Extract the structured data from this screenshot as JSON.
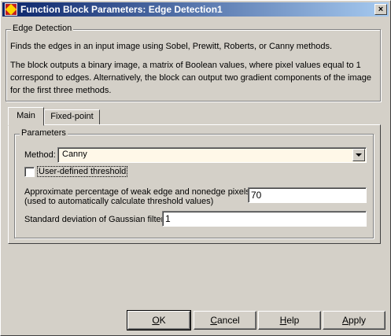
{
  "window": {
    "title": "Function Block Parameters: Edge Detection1",
    "close_symbol": "×"
  },
  "block": {
    "name": "Edge Detection",
    "description_line1": "Finds the edges in an input image using Sobel, Prewitt, Roberts, or Canny methods.",
    "description_line2": "The block outputs a binary image, a matrix of Boolean values, where pixel values equal to 1 correspond to edges.  Alternatively, the block can output two gradient components of the image for the first three methods."
  },
  "tabs": [
    {
      "label": "Main",
      "selected": true
    },
    {
      "label": "Fixed-point",
      "selected": false
    }
  ],
  "parameters": {
    "group_label": "Parameters",
    "method_label": "Method:",
    "method_value": "Canny",
    "user_threshold_label": "User-defined threshold",
    "user_threshold_checked": false,
    "weak_edge_label_line1": "Approximate percentage of weak edge and nonedge pixels:",
    "weak_edge_label_line2": "(used to automatically calculate threshold values)",
    "weak_edge_value": "70",
    "gaussian_label": "Standard deviation of Gaussian filter:",
    "gaussian_value": "1"
  },
  "buttons": {
    "ok_prefix": "",
    "ok_accel": "O",
    "ok_rest": "K",
    "cancel_prefix": "",
    "cancel_accel": "C",
    "cancel_rest": "ancel",
    "help_prefix": "",
    "help_accel": "H",
    "help_rest": "elp",
    "apply_prefix": "",
    "apply_accel": "A",
    "apply_rest": "pply"
  }
}
